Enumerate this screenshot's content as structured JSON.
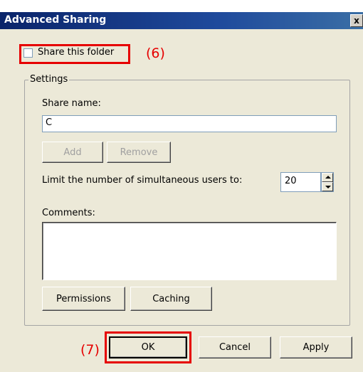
{
  "dialog": {
    "title": "Advanced Sharing",
    "close_label": "x"
  },
  "share": {
    "checkbox_label": "Share this folder",
    "checked": false,
    "callout": "(6)"
  },
  "settings": {
    "group_label": "Settings",
    "share_name_label": "Share name:",
    "share_name_value": "C",
    "add_label": "Add",
    "remove_label": "Remove",
    "limit_label": "Limit the number of simultaneous users to:",
    "limit_value": "20",
    "comments_label": "Comments:",
    "comments_value": "",
    "permissions_label": "Permissions",
    "caching_label": "Caching"
  },
  "footer": {
    "callout": "(7)",
    "ok_label": "OK",
    "cancel_label": "Cancel",
    "apply_label": "Apply"
  },
  "colors": {
    "highlight": "#e60000",
    "title_bar": "#0a246a",
    "dialog_bg": "#ece9d8"
  }
}
